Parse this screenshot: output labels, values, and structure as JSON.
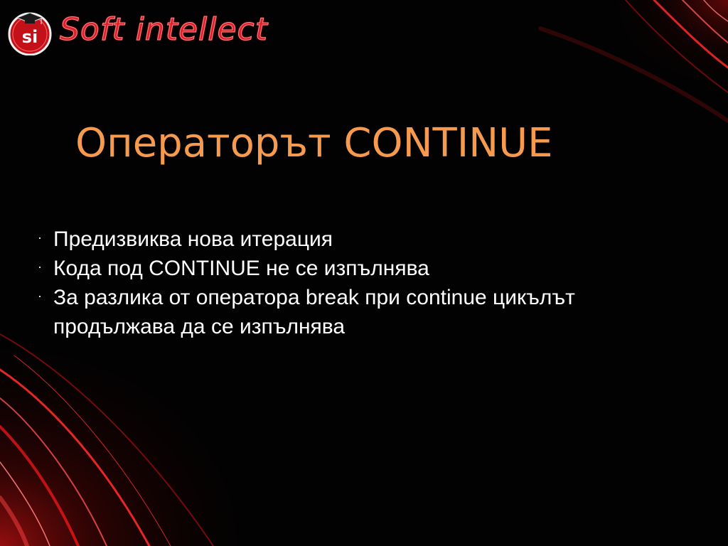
{
  "logo": {
    "badge_text": "si",
    "brand_text": "Soft intellect",
    "icon": "graduation-cap-icon"
  },
  "slide": {
    "title": "Операторът CONTINUE",
    "bullets": [
      "Предизвиква нова итерация",
      "Кода под CONTINUE не се изпълнява",
      "За разлика от оператора break при continue цикълът продължава да се изпълнява"
    ],
    "bullet_glyph": "·"
  },
  "colors": {
    "background": "#020202",
    "title": "#f59a4e",
    "body_text": "#ffffff",
    "accent_red": "#e0202a"
  }
}
